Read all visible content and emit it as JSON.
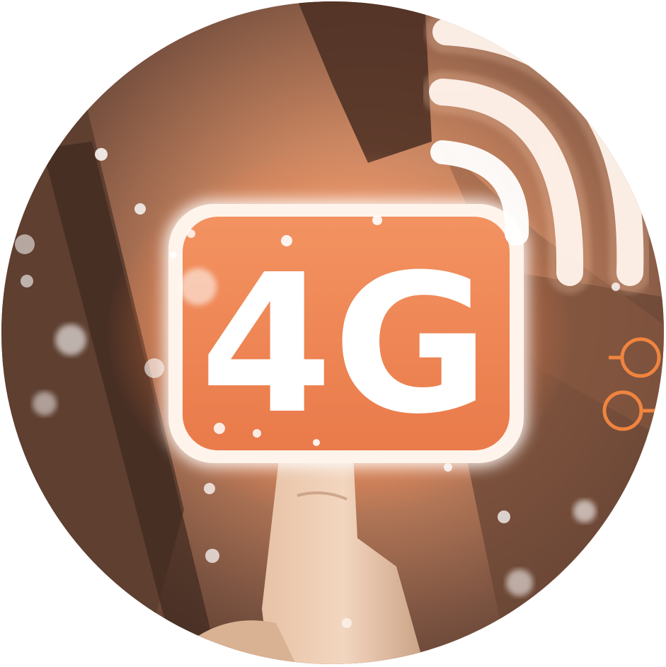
{
  "badge": {
    "label": "4G"
  },
  "icons": {
    "signal": "wifi-signal-icon",
    "nodes": "connection-nodes-icon",
    "hand": "pointing-finger"
  },
  "colors": {
    "accent": "#f07a45",
    "glow": "#ffb080",
    "dark": "#3a2418",
    "suit": "#6b4a38",
    "white": "#ffffff"
  }
}
